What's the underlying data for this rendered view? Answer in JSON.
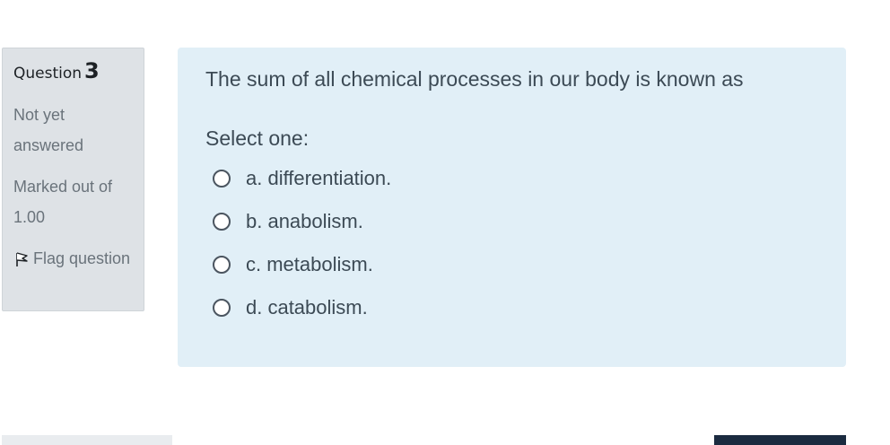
{
  "info": {
    "question_label": "Question",
    "question_number": "3",
    "state": "Not yet answered",
    "grade": "Marked out of 1.00",
    "flag_label": "Flag question"
  },
  "content": {
    "question_text": "The sum of all chemical processes in our body is known as",
    "prompt": "Select one:",
    "options": [
      {
        "label": "a. differentiation."
      },
      {
        "label": "b. anabolism."
      },
      {
        "label": "c. metabolism."
      },
      {
        "label": "d. catabolism."
      }
    ]
  },
  "icons": {
    "flag": "flag-icon"
  },
  "colors": {
    "info_bg": "#dee2e6",
    "content_bg": "#e1eff7",
    "text": "#3c4a55",
    "muted_text": "#6a737b",
    "nav_button_dark": "#1b2b40"
  }
}
